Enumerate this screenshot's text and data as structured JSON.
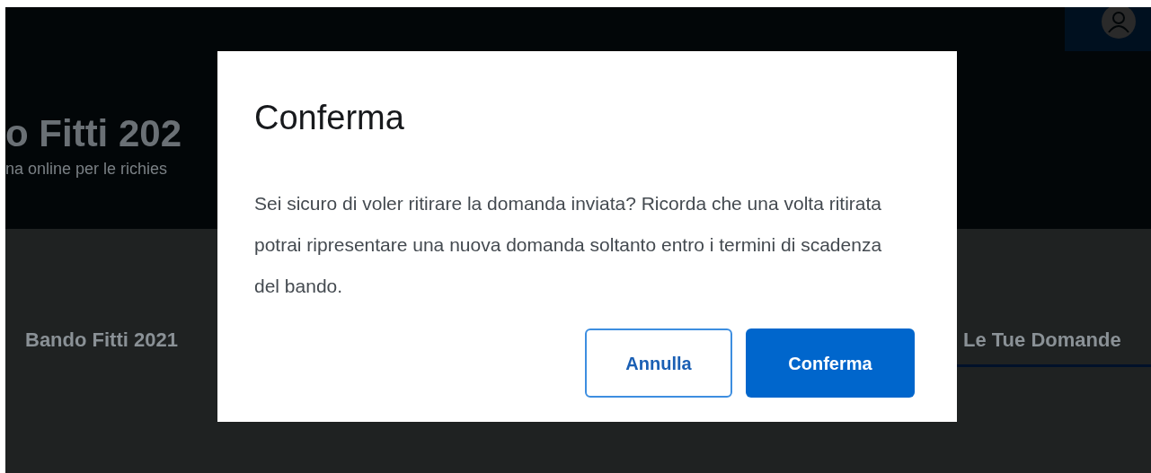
{
  "header": {
    "title": "o Fitti 202",
    "subtitle": "na online per le richies"
  },
  "tabs": [
    {
      "label": "Bando Fitti 2021",
      "selected": false
    },
    {
      "label": "Le Tue Domande",
      "selected": true
    }
  ],
  "dialog": {
    "title": "Conferma",
    "message": "Sei sicuro di voler ritirare la domanda inviata? Ricorda che una volta ritirata potrai ripresentare una nuova domanda soltanto entro i termini di scadenza del bando.",
    "buttons": [
      {
        "label": "Annulla",
        "kind": "secondary"
      },
      {
        "label": "Conferma",
        "kind": "primary"
      }
    ]
  }
}
